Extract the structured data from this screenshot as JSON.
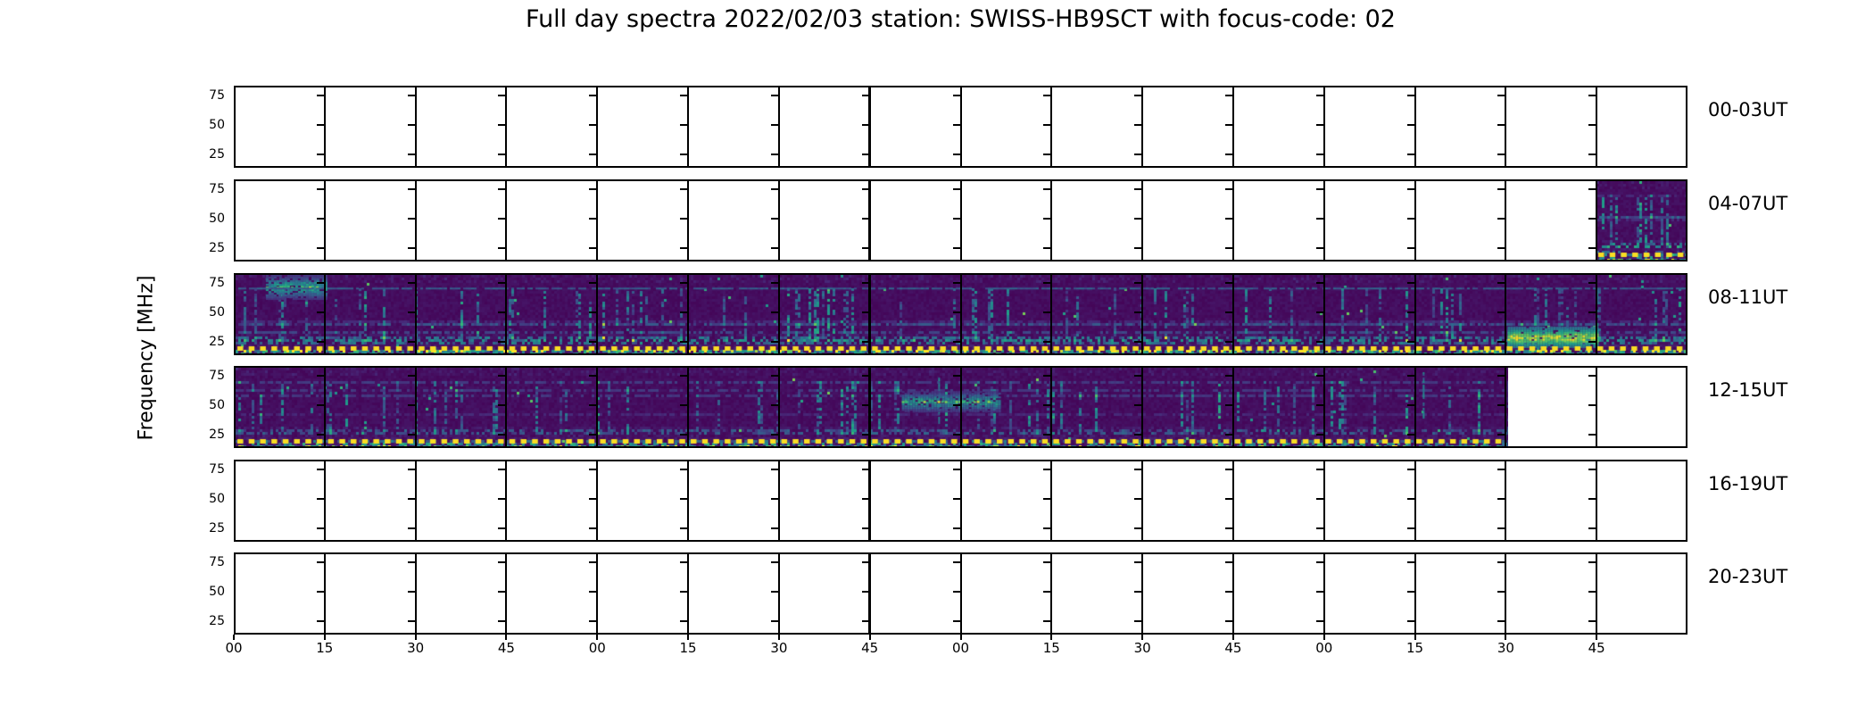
{
  "chart_data": {
    "type": "heatmap",
    "title": "Full day spectra 2022/02/03 station: SWISS-HB9SCT with focus-code: 02",
    "ylabel": "Frequency [MHz]",
    "colormap": "viridis",
    "station": "SWISS-HB9SCT",
    "date": "2022/02/03",
    "focus_code": "02",
    "minutes_per_row": 240,
    "slot_minutes": 15,
    "n_slots_per_row": 16,
    "freq_range_mhz": [
      14,
      84
    ],
    "ytick_labels": [
      "75",
      "50",
      "25"
    ],
    "yticks_mhz": [
      75,
      50,
      25
    ],
    "xtick_labels": [
      "00",
      "15",
      "30",
      "45",
      "00",
      "15",
      "30",
      "45",
      "00",
      "15",
      "30",
      "45",
      "00",
      "15",
      "30",
      "45"
    ],
    "grid": "subplot separators every 15 minutes",
    "legend": "none",
    "colors": {
      "figure_background": "#ffffff",
      "axes": "#000000",
      "empty_panel": "#ffffff",
      "spectrogram_base": "#440a5f",
      "streak_teal": "#26828e",
      "streak_green": "#35b779",
      "bright_yellow": "#fde725",
      "marker_dash": "#f9dd23"
    },
    "rows": [
      {
        "label": "00-03UT",
        "coverage_min": [],
        "marker_line": false,
        "features": []
      },
      {
        "label": "04-07UT",
        "coverage_min": [
          [
            225,
            240
          ]
        ],
        "marker_line": true,
        "features": []
      },
      {
        "label": "08-11UT",
        "coverage_min": [
          [
            0,
            240
          ]
        ],
        "marker_line": true,
        "features": [
          {
            "kind": "patch",
            "desc": "bright emission patch",
            "t_min": [
              5,
              15
            ],
            "f_mhz": [
              62,
              84
            ]
          },
          {
            "kind": "hline",
            "desc": "persistent narrowband carrier",
            "f_mhz": 71
          },
          {
            "kind": "band",
            "desc": "strong broadband RFI band",
            "t_min": [
              210,
              225
            ],
            "f_mhz": [
              20,
              38
            ]
          }
        ]
      },
      {
        "label": "12-15UT",
        "coverage_min": [
          [
            0,
            210
          ]
        ],
        "marker_line": true,
        "features": [
          {
            "kind": "vline",
            "desc": "vertical burst streak",
            "t_min": 116,
            "f_mhz": [
              35,
              75
            ]
          },
          {
            "kind": "patch",
            "desc": "faint enhancement",
            "t_min": [
              110,
              126
            ],
            "f_mhz": [
              45,
              62
            ]
          },
          {
            "kind": "vline",
            "desc": "vertical burst streak",
            "t_min": 196,
            "f_mhz": [
              40,
              78
            ]
          }
        ]
      },
      {
        "label": "16-19UT",
        "coverage_min": [],
        "marker_line": false,
        "features": []
      },
      {
        "label": "20-23UT",
        "coverage_min": [],
        "marker_line": false,
        "features": []
      }
    ]
  }
}
